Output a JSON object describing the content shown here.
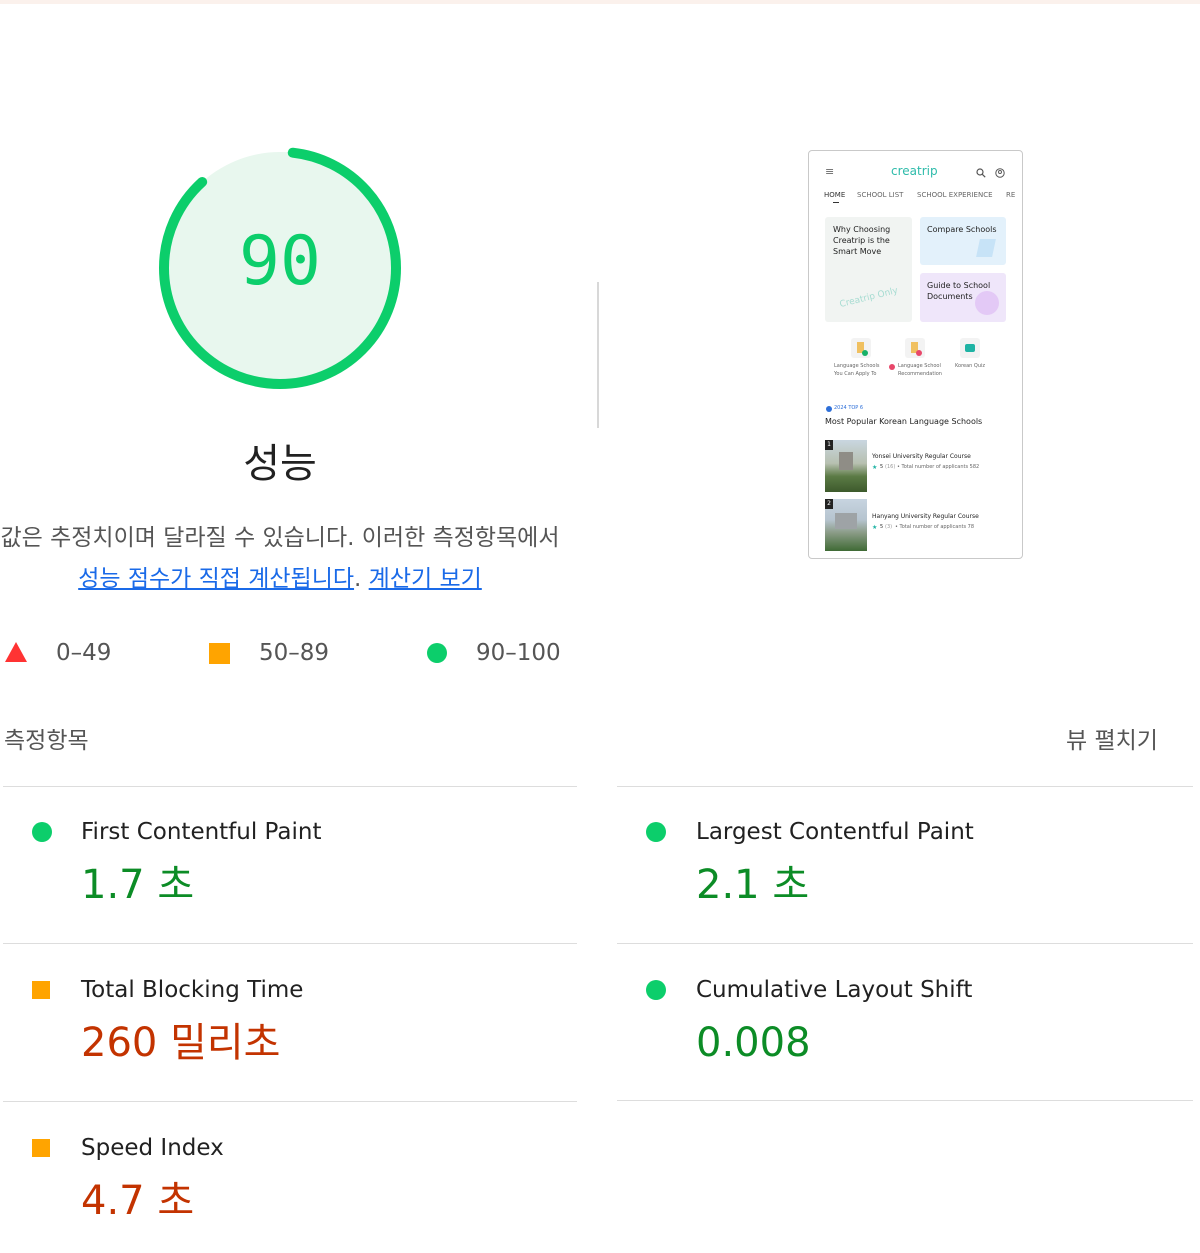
{
  "gauge": {
    "score": "90",
    "score_fraction": 0.9,
    "title": "성능",
    "color": "#0cce6b",
    "track_fill": "#e8f7ee"
  },
  "description": {
    "text_before": "값은 추정치이며 달라질 수 있습니다. 이러한 측정항목에서 ",
    "link1": "성능 점수가 직접 계산됩니다",
    "text_middle": ". ",
    "link2": "계산기 보기"
  },
  "legend": {
    "fail": "0–49",
    "average": "50–89",
    "pass": "90–100",
    "colors": {
      "fail": "#ff3333",
      "average": "#ffa400",
      "pass": "#0cce6b"
    }
  },
  "thumbnail": {
    "brand": "creatrip",
    "nav": [
      "HOME",
      "SCHOOL LIST",
      "SCHOOL EXPERIENCE",
      "RE"
    ],
    "card1": {
      "line1": "Why Choosing",
      "line2": "Creatrip is the",
      "line3": "Smart Move",
      "stamp": "Creatrip Only"
    },
    "card2": {
      "title": "Compare Schools"
    },
    "card3": {
      "line1": "Guide to School",
      "line2": "Documents"
    },
    "shortcuts": [
      {
        "line1": "Language Schools",
        "line2": "You Can Apply To"
      },
      {
        "line1": "Language School",
        "line2": "Recommendation"
      },
      {
        "line1": "Korean Quiz",
        "line2": ""
      }
    ],
    "badge": "2024 TOP 6",
    "heading": "Most Popular Korean Language Schools",
    "schools": [
      {
        "rank": "1",
        "name": "Yonsei University Regular Course",
        "rating": "5",
        "reviews": "(16)",
        "applicants": "• Total number of applicants 582"
      },
      {
        "rank": "2",
        "name": "Hanyang University Regular Course",
        "rating": "5",
        "reviews": "(3)",
        "applicants": "• Total number of applicants 78"
      }
    ]
  },
  "metrics_section": {
    "title": "측정항목",
    "expand_label": "뷰 펼치기"
  },
  "metrics": [
    {
      "title": "First Contentful Paint",
      "value": "1.7 초",
      "status": "pass"
    },
    {
      "title": "Largest Contentful Paint",
      "value": "2.1 초",
      "status": "pass"
    },
    {
      "title": "Total Blocking Time",
      "value": "260 밀리초",
      "status": "average"
    },
    {
      "title": "Cumulative Layout Shift",
      "value": "0.008",
      "status": "pass"
    },
    {
      "title": "Speed Index",
      "value": "4.7 초",
      "status": "average"
    }
  ]
}
